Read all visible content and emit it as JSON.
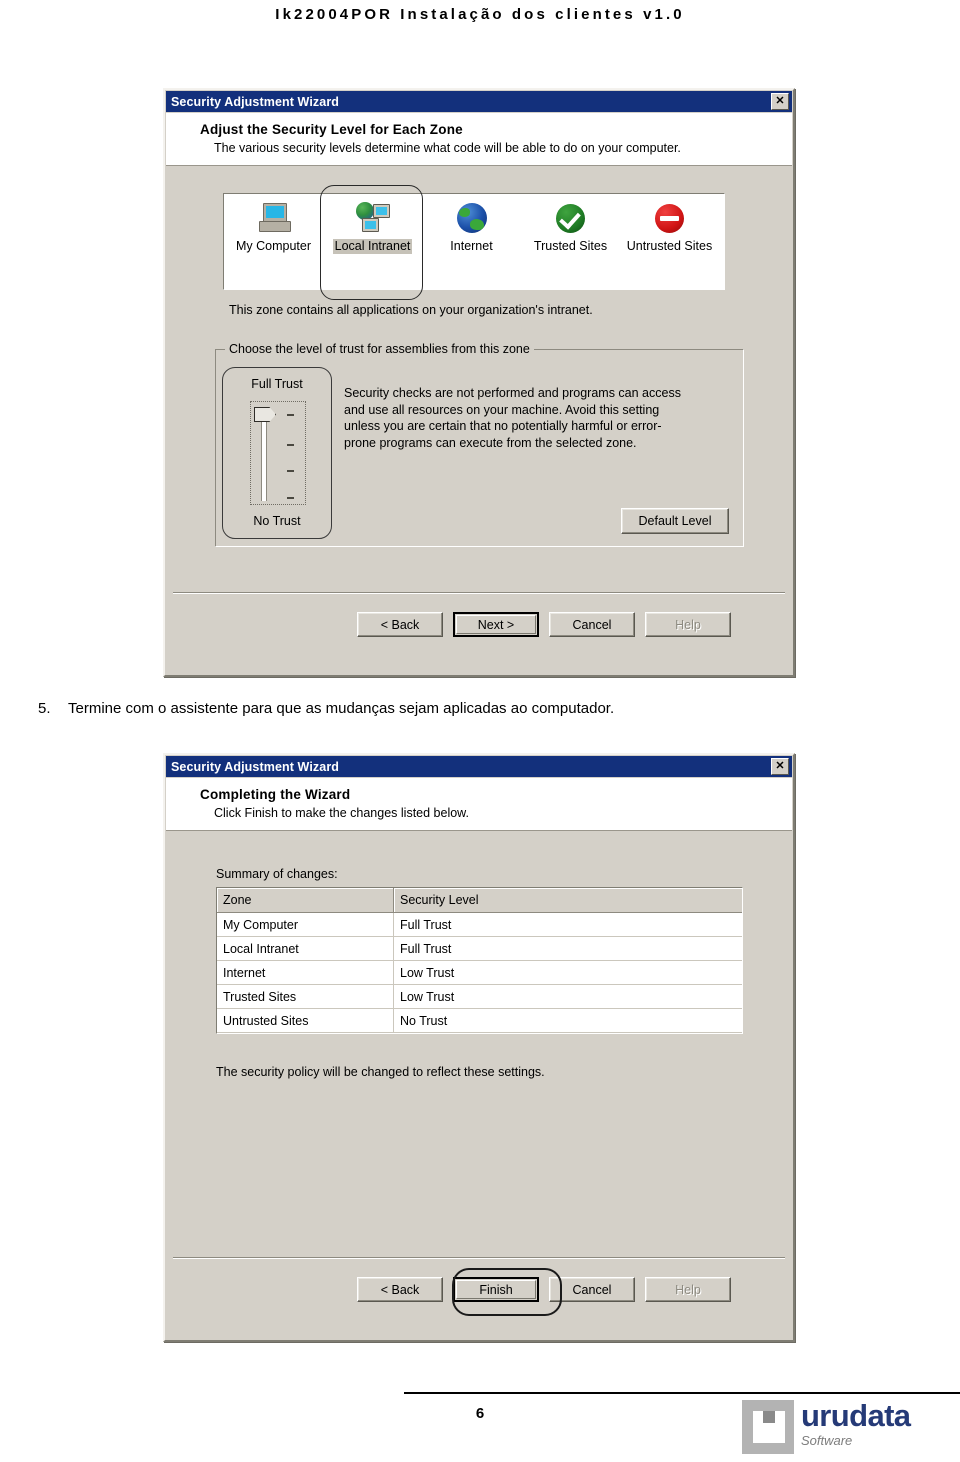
{
  "document": {
    "header": "Ik22004POR Instalação dos clientes v1.0",
    "page_number": "6"
  },
  "instruction": {
    "number": "5.",
    "text": "Termine com o assistente para que as mudanças sejam aplicadas ao computador."
  },
  "dialog1": {
    "title": "Security Adjustment Wizard",
    "close_label": "✕",
    "heading": "Adjust the Security Level for Each Zone",
    "subheading": "The various security levels determine what code will be able to do on your computer.",
    "zones": [
      {
        "label": "My Computer",
        "icon": "computer-icon",
        "selected": false
      },
      {
        "label": "Local Intranet",
        "icon": "intranet-icon",
        "selected": true
      },
      {
        "label": "Internet",
        "icon": "globe-icon",
        "selected": false
      },
      {
        "label": "Trusted Sites",
        "icon": "green-check-icon",
        "selected": false
      },
      {
        "label": "Untrusted Sites",
        "icon": "red-deny-icon",
        "selected": false
      }
    ],
    "zone_description": "This zone contains all applications on your organization's intranet.",
    "groupbox_title": "Choose the level of trust for assemblies from this zone",
    "slider_top_label": "Full Trust",
    "slider_bottom_label": "No Trust",
    "trust_description": "Security checks are not performed and programs can access and use all resources on your machine.  Avoid this setting unless you are certain that no potentially harmful or error-prone programs can execute from the selected zone.",
    "default_level_button": "Default Level",
    "buttons": [
      {
        "label": "< Back",
        "state": "normal"
      },
      {
        "label": "Next >",
        "state": "default"
      },
      {
        "label": "Cancel",
        "state": "normal"
      },
      {
        "label": "Help",
        "state": "disabled"
      }
    ]
  },
  "dialog2": {
    "title": "Security Adjustment Wizard",
    "close_label": "✕",
    "heading": "Completing the Wizard",
    "subheading": "Click Finish to make the changes listed below.",
    "summary_label": "Summary of changes:",
    "table": {
      "columns": [
        "Zone",
        "Security Level"
      ],
      "rows": [
        [
          "My Computer",
          "Full Trust"
        ],
        [
          "Local Intranet",
          "Full Trust"
        ],
        [
          "Internet",
          "Low Trust"
        ],
        [
          "Trusted Sites",
          "Low Trust"
        ],
        [
          "Untrusted Sites",
          "No Trust"
        ]
      ]
    },
    "note": "The security policy will be changed to reflect these settings.",
    "buttons": [
      {
        "label": "< Back",
        "state": "normal"
      },
      {
        "label": "Finish",
        "state": "default-focused"
      },
      {
        "label": "Cancel",
        "state": "normal"
      },
      {
        "label": "Help",
        "state": "disabled"
      }
    ]
  },
  "logo": {
    "word": "urudata",
    "sub": "Software",
    "word_color": "#253a77",
    "sub_color": "#7d7d7d",
    "mark_color": "#b3b3b3"
  }
}
